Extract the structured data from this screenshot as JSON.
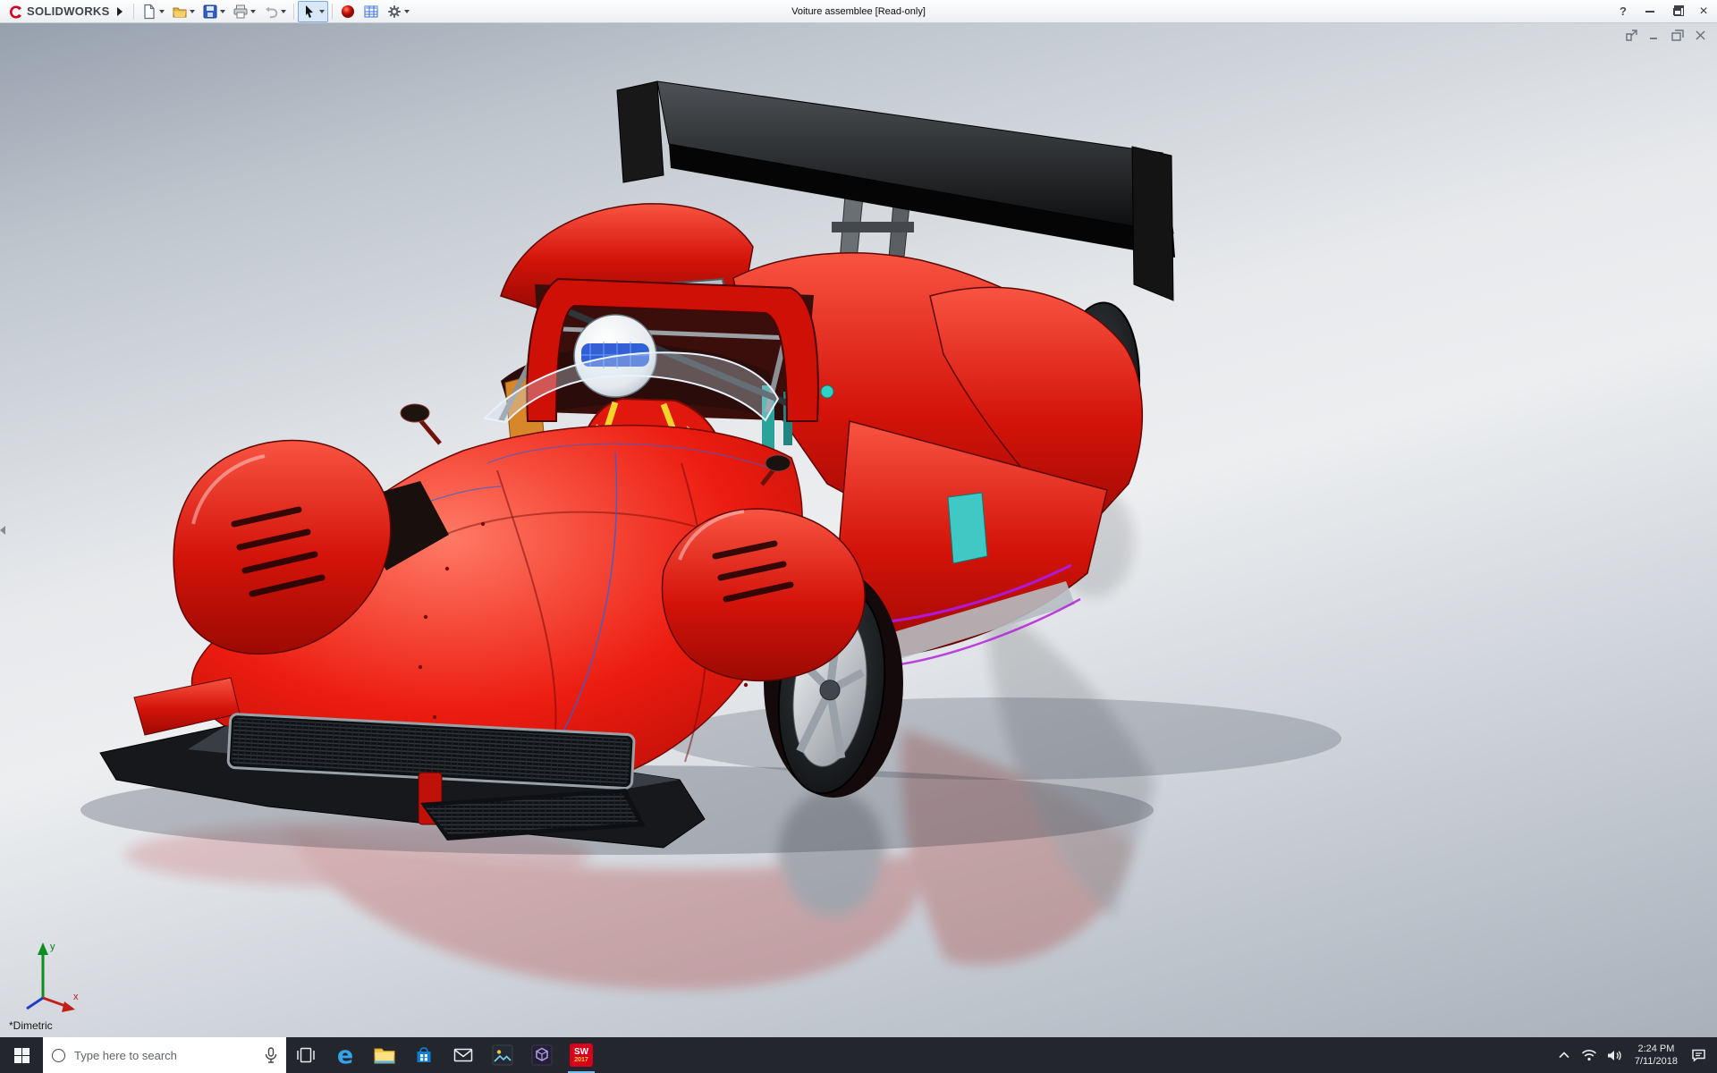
{
  "titlebar": {
    "brand": "SOLIDWORKS",
    "title": "Voiture assemblee [Read-only]",
    "help_glyph": "?",
    "close_glyph": "×"
  },
  "toolbar": {
    "buttons": [
      "new-document",
      "open",
      "save",
      "print",
      "undo",
      "select",
      "appearances",
      "design-table",
      "options"
    ]
  },
  "viewport": {
    "view_orientation": "*Dimetric",
    "triad": {
      "x": "x",
      "y": "y"
    }
  },
  "taskbar": {
    "search_placeholder": "Type here to search",
    "edge_glyph": "e",
    "solidworks_badge": {
      "top": "SW",
      "year": "2017"
    },
    "apps": [
      "task-view",
      "edge",
      "file-explorer",
      "store",
      "mail",
      "photos",
      "3d-viewer",
      "solidworks-2017"
    ],
    "tray": {
      "time": "2:24 PM",
      "date": "7/11/2018"
    }
  }
}
